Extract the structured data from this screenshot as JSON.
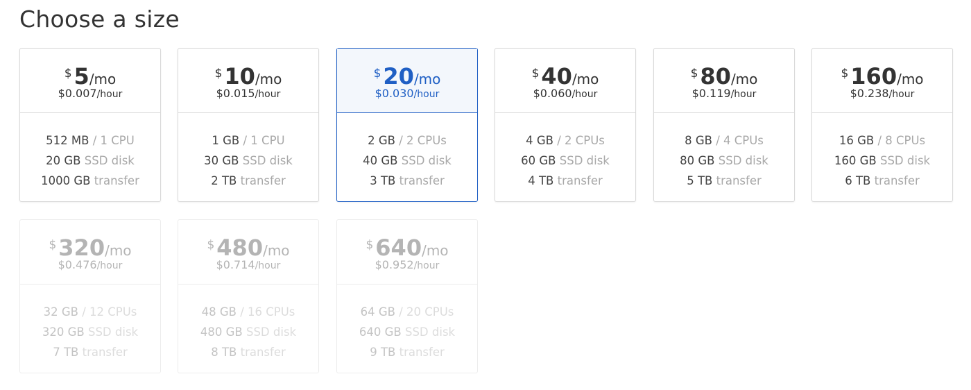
{
  "heading": "Choose a size",
  "currency_symbol": "$",
  "per_month": "/mo",
  "per_hour": "/hour",
  "colors": {
    "selected_accent": "#1f5fc4",
    "selected_background": "#f3f7fc",
    "border": "#d9d9d9",
    "muted_text": "#a8a8a8",
    "disabled_text": "#c4c4c4"
  },
  "sizes": [
    {
      "monthly": "5",
      "hourly": "$0.007",
      "memory": "512 MB",
      "cpu": "/ 1 CPU",
      "disk": "20 GB",
      "disk_label": "SSD disk",
      "transfer": "1000 GB",
      "transfer_label": "transfer",
      "state": "available"
    },
    {
      "monthly": "10",
      "hourly": "$0.015",
      "memory": "1 GB",
      "cpu": "/ 1 CPU",
      "disk": "30 GB",
      "disk_label": "SSD disk",
      "transfer": "2 TB",
      "transfer_label": "transfer",
      "state": "available"
    },
    {
      "monthly": "20",
      "hourly": "$0.030",
      "memory": "2 GB",
      "cpu": "/ 2 CPUs",
      "disk": "40 GB",
      "disk_label": "SSD disk",
      "transfer": "3 TB",
      "transfer_label": "transfer",
      "state": "selected"
    },
    {
      "monthly": "40",
      "hourly": "$0.060",
      "memory": "4 GB",
      "cpu": "/ 2 CPUs",
      "disk": "60 GB",
      "disk_label": "SSD disk",
      "transfer": "4 TB",
      "transfer_label": "transfer",
      "state": "available"
    },
    {
      "monthly": "80",
      "hourly": "$0.119",
      "memory": "8 GB",
      "cpu": "/ 4 CPUs",
      "disk": "80 GB",
      "disk_label": "SSD disk",
      "transfer": "5 TB",
      "transfer_label": "transfer",
      "state": "available"
    },
    {
      "monthly": "160",
      "hourly": "$0.238",
      "memory": "16 GB",
      "cpu": "/ 8 CPUs",
      "disk": "160 GB",
      "disk_label": "SSD disk",
      "transfer": "6 TB",
      "transfer_label": "transfer",
      "state": "available"
    },
    {
      "monthly": "320",
      "hourly": "$0.476",
      "memory": "32 GB",
      "cpu": "/ 12 CPUs",
      "disk": "320 GB",
      "disk_label": "SSD disk",
      "transfer": "7 TB",
      "transfer_label": "transfer",
      "state": "disabled"
    },
    {
      "monthly": "480",
      "hourly": "$0.714",
      "memory": "48 GB",
      "cpu": "/ 16 CPUs",
      "disk": "480 GB",
      "disk_label": "SSD disk",
      "transfer": "8 TB",
      "transfer_label": "transfer",
      "state": "disabled"
    },
    {
      "monthly": "640",
      "hourly": "$0.952",
      "memory": "64 GB",
      "cpu": "/ 20 CPUs",
      "disk": "640 GB",
      "disk_label": "SSD disk",
      "transfer": "9 TB",
      "transfer_label": "transfer",
      "state": "disabled"
    }
  ]
}
